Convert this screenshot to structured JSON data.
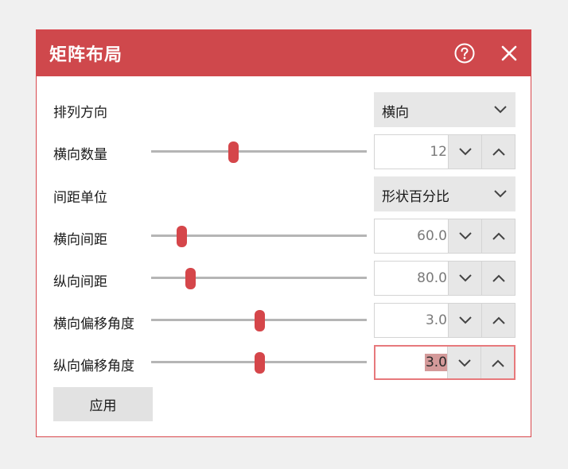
{
  "dialog": {
    "title": "矩阵布局",
    "help_icon": "help-circle-icon",
    "close_icon": "close-icon"
  },
  "rows": {
    "arrangement": {
      "label": "排列方向",
      "value": "横向"
    },
    "horizontal_count": {
      "label": "横向数量",
      "value": "12",
      "slider_fraction": 0.38
    },
    "spacing_unit": {
      "label": "间距单位",
      "value": "形状百分比"
    },
    "horizontal_spacing": {
      "label": "横向间距",
      "value": "60.0",
      "slider_fraction": 0.14
    },
    "vertical_spacing": {
      "label": "纵向间距",
      "value": "80.0",
      "slider_fraction": 0.18
    },
    "horizontal_offset_angle": {
      "label": "横向偏移角度",
      "value": "3.0",
      "slider_fraction": 0.5
    },
    "vertical_offset_angle": {
      "label": "纵向偏移角度",
      "value": "3.0",
      "slider_fraction": 0.5
    }
  },
  "apply_label": "应用",
  "colors": {
    "accent": "#cf484c",
    "focus_border": "#e7797c",
    "control_bg": "#e7e7e7"
  }
}
